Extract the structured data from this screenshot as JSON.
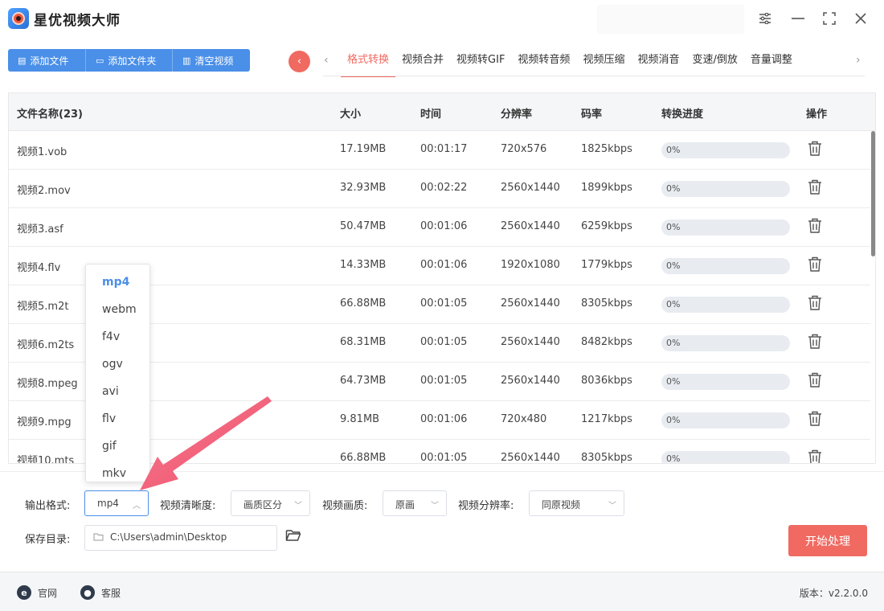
{
  "app": {
    "title": "星优视频大师"
  },
  "toolbar": {
    "add_file": "添加文件",
    "add_folder": "添加文件夹",
    "clear_videos": "清空视频"
  },
  "tabs": [
    "格式转换",
    "视频合并",
    "视频转GIF",
    "视频转音频",
    "视频压缩",
    "视频消音",
    "变速/倒放",
    "音量调整"
  ],
  "table": {
    "headers": [
      "文件名称(23)",
      "大小",
      "时间",
      "分辨率",
      "码率",
      "转换进度",
      "操作"
    ],
    "rows": [
      {
        "name": "视频1.vob",
        "size": "17.19MB",
        "time": "00:01:17",
        "resolution": "720x576",
        "bitrate": "1825kbps",
        "progress": "0%"
      },
      {
        "name": "视频2.mov",
        "size": "32.93MB",
        "time": "00:02:22",
        "resolution": "2560x1440",
        "bitrate": "1899kbps",
        "progress": "0%"
      },
      {
        "name": "视频3.asf",
        "size": "50.47MB",
        "time": "00:01:06",
        "resolution": "2560x1440",
        "bitrate": "6259kbps",
        "progress": "0%"
      },
      {
        "name": "视频4.flv",
        "size": "14.33MB",
        "time": "00:01:06",
        "resolution": "1920x1080",
        "bitrate": "1779kbps",
        "progress": "0%"
      },
      {
        "name": "视频5.m2t",
        "size": "66.88MB",
        "time": "00:01:05",
        "resolution": "2560x1440",
        "bitrate": "8305kbps",
        "progress": "0%"
      },
      {
        "name": "视频6.m2ts",
        "size": "68.31MB",
        "time": "00:01:05",
        "resolution": "2560x1440",
        "bitrate": "8482kbps",
        "progress": "0%"
      },
      {
        "name": "视频8.mpeg",
        "size": "64.73MB",
        "time": "00:01:05",
        "resolution": "2560x1440",
        "bitrate": "8036kbps",
        "progress": "0%"
      },
      {
        "name": "视频9.mpg",
        "size": "9.81MB",
        "time": "00:01:06",
        "resolution": "720x480",
        "bitrate": "1217kbps",
        "progress": "0%"
      },
      {
        "name": "视频10.mts",
        "size": "66.88MB",
        "time": "00:01:05",
        "resolution": "2560x1440",
        "bitrate": "8305kbps",
        "progress": "0%"
      }
    ]
  },
  "format_dropdown": {
    "options": [
      "mp4",
      "webm",
      "f4v",
      "ogv",
      "avi",
      "flv",
      "gif",
      "mkv"
    ],
    "selected": "mp4"
  },
  "settings": {
    "output_format_label": "输出格式:",
    "output_format_value": "mp4",
    "clarity_label": "视频清晰度:",
    "clarity_value": "画质区分",
    "quality_label": "视频画质:",
    "quality_value": "原画",
    "resolution_label": "视频分辨率:",
    "resolution_value": "同原视频",
    "save_dir_label": "保存目录:",
    "save_dir_value": "C:\\Users\\admin\\Desktop",
    "start_button": "开始处理"
  },
  "footer": {
    "website": "官网",
    "support": "客服",
    "version": "版本：v2.2.0.0"
  },
  "colors": {
    "accent_blue": "#4a8fe8",
    "accent_red": "#f06a62",
    "arrow_pink": "#f0506e"
  }
}
